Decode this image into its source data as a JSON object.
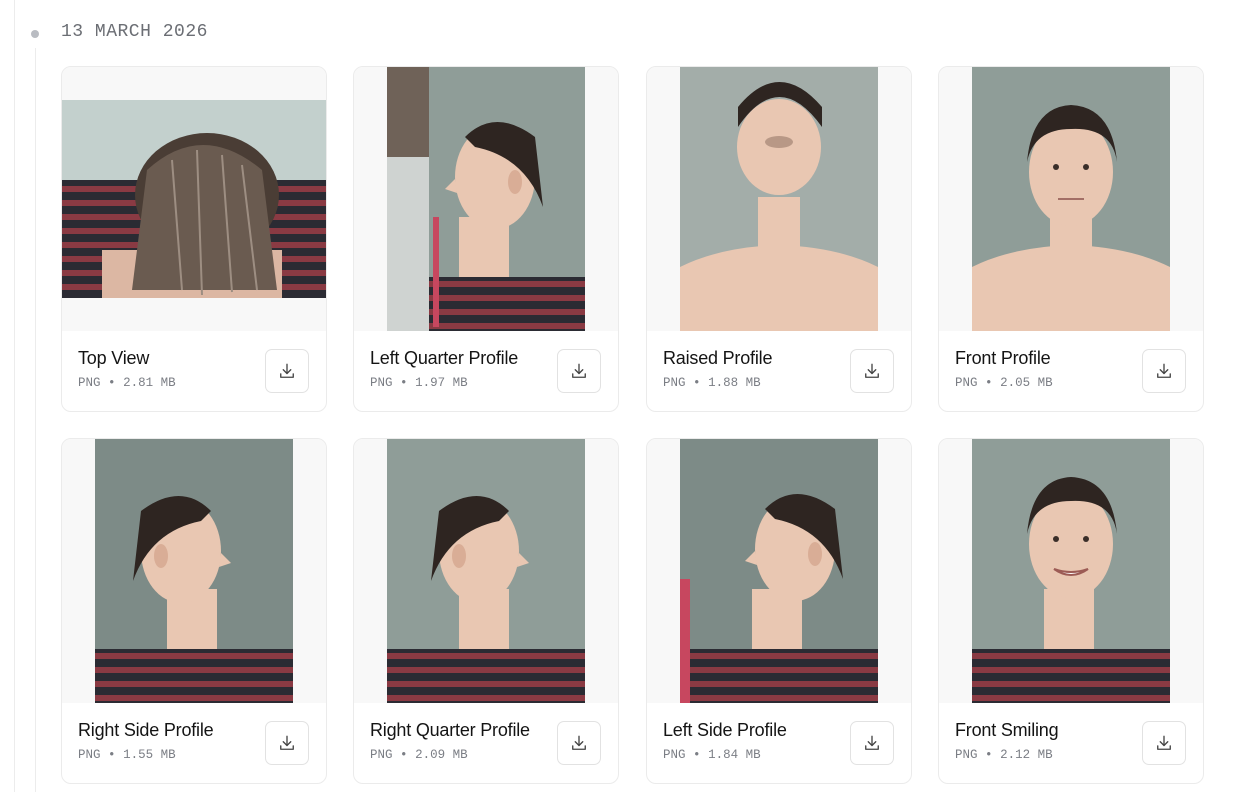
{
  "timeline": {
    "date_heading": "13 MARCH 2026"
  },
  "colors": {
    "wall": "#8f9d98",
    "skin": "#e9c7b2",
    "hair": "#2e2521",
    "shirt_dark": "#2b2b33",
    "shirt_stripe": "#8a3a43",
    "card_border": "#ebebeb"
  },
  "photos": [
    {
      "title": "Top View",
      "format": "PNG",
      "separator": "•",
      "size": "2.81 MB",
      "download_icon": "download-icon"
    },
    {
      "title": "Left Quarter Profile",
      "format": "PNG",
      "separator": "•",
      "size": "1.97 MB",
      "download_icon": "download-icon"
    },
    {
      "title": "Raised Profile",
      "format": "PNG",
      "separator": "•",
      "size": "1.88 MB",
      "download_icon": "download-icon"
    },
    {
      "title": "Front Profile",
      "format": "PNG",
      "separator": "•",
      "size": "2.05 MB",
      "download_icon": "download-icon"
    },
    {
      "title": "Right Side Profile",
      "format": "PNG",
      "separator": "•",
      "size": "1.55 MB",
      "download_icon": "download-icon"
    },
    {
      "title": "Right Quarter Profile",
      "format": "PNG",
      "separator": "•",
      "size": "2.09 MB",
      "download_icon": "download-icon"
    },
    {
      "title": "Left Side Profile",
      "format": "PNG",
      "separator": "•",
      "size": "1.84 MB",
      "download_icon": "download-icon"
    },
    {
      "title": "Front Smiling",
      "format": "PNG",
      "separator": "•",
      "size": "2.12 MB",
      "download_icon": "download-icon"
    }
  ]
}
